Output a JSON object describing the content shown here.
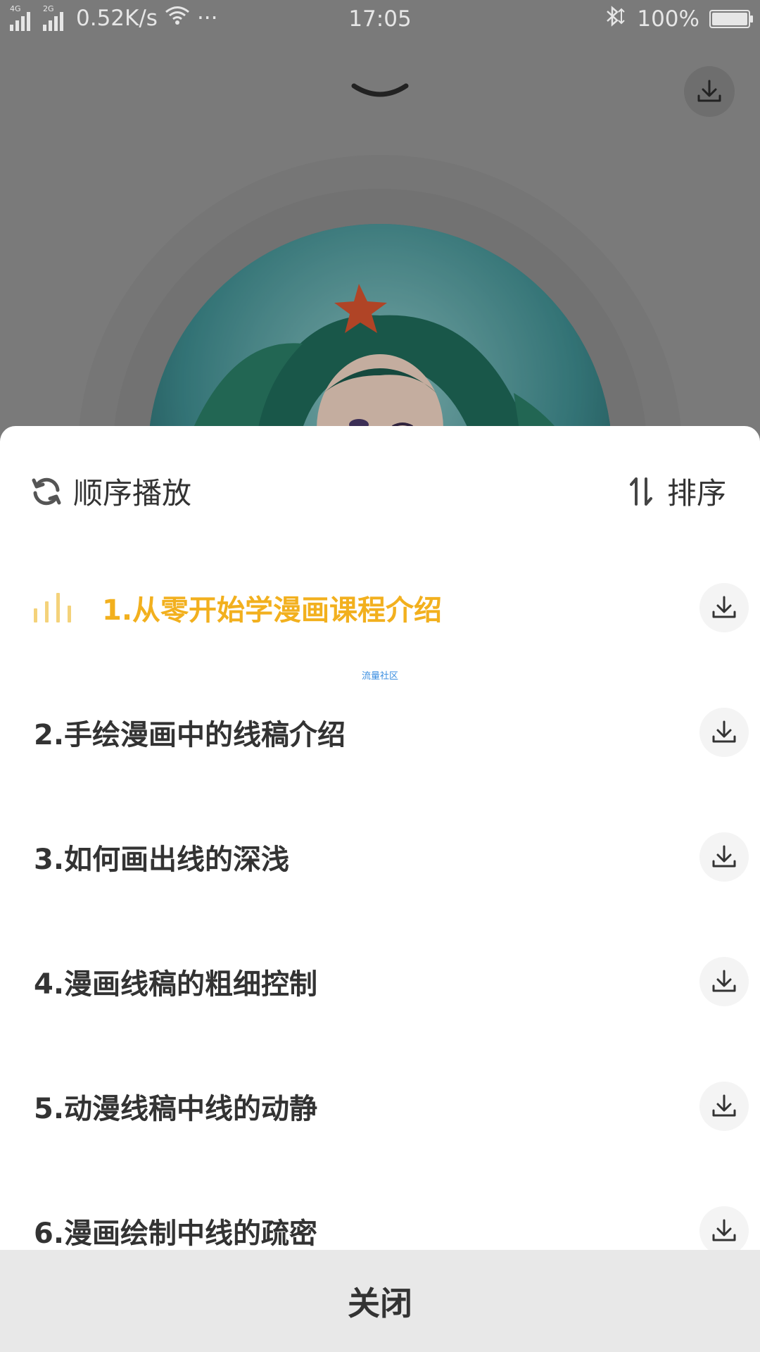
{
  "status_bar": {
    "network_1": "4G",
    "network_2": "2G",
    "speed": "0.52K/s",
    "more": "···",
    "time": "17:05",
    "battery_text": "100%",
    "battery_level": 1.0,
    "icons": [
      "signal-icon",
      "wifi-icon",
      "bluetooth-icon",
      "battery-icon"
    ]
  },
  "player": {
    "collapse_icon": "chevron-down-icon",
    "download_icon": "download-icon"
  },
  "playlist": {
    "mode_label": "顺序播放",
    "sort_label": "排序",
    "watermark": "流量社区",
    "tracks": [
      {
        "title": "1.从零开始学漫画课程介绍",
        "playing": true
      },
      {
        "title": "2.手绘漫画中的线稿介绍",
        "playing": false
      },
      {
        "title": "3.如何画出线的深浅",
        "playing": false
      },
      {
        "title": "4.漫画线稿的粗细控制",
        "playing": false
      },
      {
        "title": "5.动漫线稿中线的动静",
        "playing": false
      },
      {
        "title": "6.漫画绘制中线的疏密",
        "playing": false
      }
    ],
    "close_label": "关闭"
  },
  "colors": {
    "accent": "#f2b01e",
    "overlay": "#7a7a7a",
    "text": "#333333"
  }
}
